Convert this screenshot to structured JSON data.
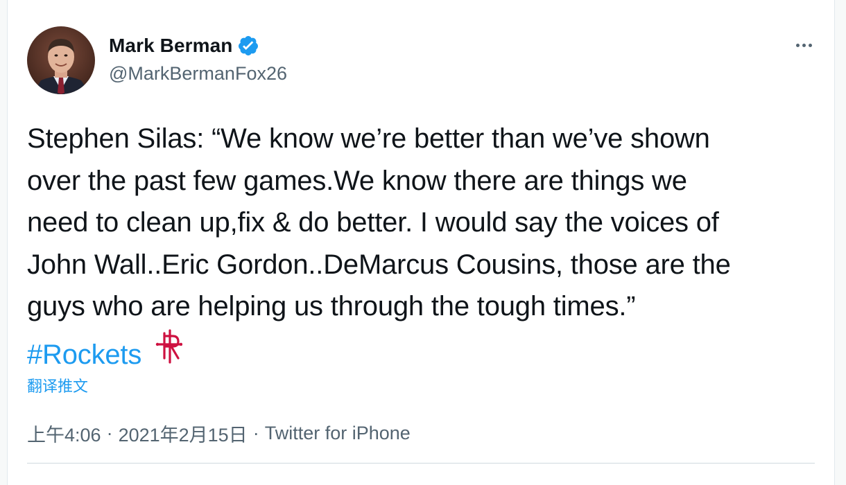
{
  "author": {
    "name": "Mark Berman",
    "handle": "@MarkBermanFox26",
    "verified": true
  },
  "tweet": {
    "lines": [
      "Stephen Silas: “We know we’re better than we’ve shown",
      "over the past few games.We know there are things we",
      "need to clean up,fix & do better. I would say the voices of",
      "John Wall..Eric Gordon..DeMarcus Cousins, those are the",
      "guys who are helping us through the tough times.”"
    ],
    "hashtag": "#Rockets",
    "emoji": "rockets-logo-icon"
  },
  "translate_label": "翻译推文",
  "meta": {
    "time": "上午4:06",
    "separator": "·",
    "date": "2021年2月15日",
    "source": "Twitter for iPhone"
  },
  "colors": {
    "link": "#1d9bf0",
    "text": "#0f1419",
    "secondary": "#536471",
    "rockets_red": "#ce1141"
  }
}
